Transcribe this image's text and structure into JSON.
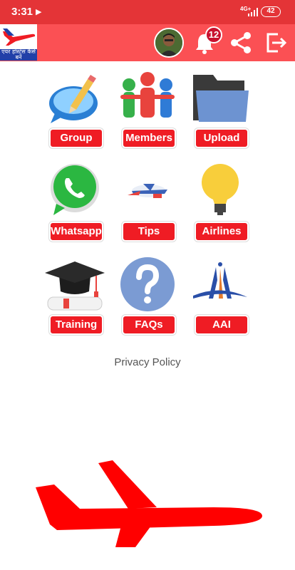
{
  "status_bar": {
    "time": "3:31",
    "network": "4G+",
    "battery": "42"
  },
  "app_bar": {
    "logo_text": "एयर होस्टेस कैसे बनें",
    "notification_count": "12"
  },
  "tiles": [
    {
      "label": "Group",
      "icon": "pencil-chat-icon"
    },
    {
      "label": "Members",
      "icon": "members-icon"
    },
    {
      "label": "Upload",
      "icon": "folder-icon"
    },
    {
      "label": "Whatsapp",
      "icon": "whatsapp-icon"
    },
    {
      "label": "Tips",
      "icon": "plane-tips-icon"
    },
    {
      "label": "Airlines",
      "icon": "lightbulb-icon"
    },
    {
      "label": "Training",
      "icon": "graduation-cap-icon"
    },
    {
      "label": "FAQs",
      "icon": "question-icon"
    },
    {
      "label": "AAI",
      "icon": "aai-logo-icon"
    }
  ],
  "footer": {
    "privacy": "Privacy Policy"
  },
  "colors": {
    "status": "#e43437",
    "appbar": "#fb5054",
    "button": "#ef1c24"
  }
}
